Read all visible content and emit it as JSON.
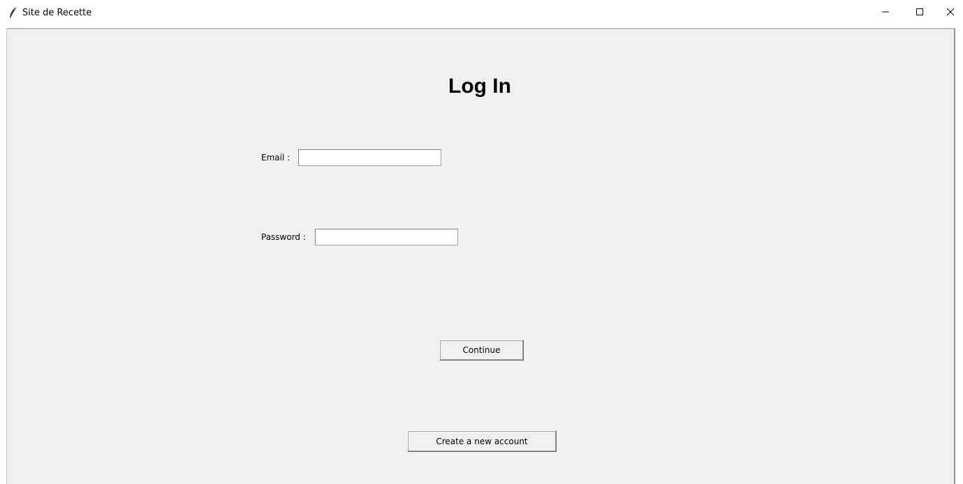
{
  "window": {
    "title": "Site de Recette",
    "icon": "feather-icon",
    "controls": [
      "minimize-icon",
      "maximize-icon",
      "close-icon"
    ]
  },
  "login": {
    "heading": "Log In",
    "email_label": "Email :",
    "email_value": "",
    "password_label": "Password :",
    "password_value": "",
    "continue_label": "Continue",
    "create_account_label": "Create a new account"
  },
  "colors": {
    "client_background": "#f0f0f0",
    "titlebar_background": "#ffffff",
    "input_background": "#ffffff"
  }
}
